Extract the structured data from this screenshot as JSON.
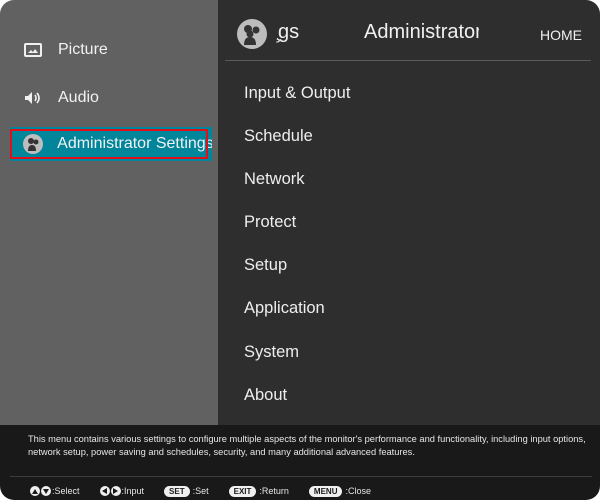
{
  "sidebar": {
    "items": [
      {
        "label": "Picture",
        "icon": "picture-icon",
        "active": false
      },
      {
        "label": "Audio",
        "icon": "speaker-icon",
        "active": false
      },
      {
        "label": "Administrator Settings",
        "icon": "admin-gears-icon",
        "active": true
      }
    ]
  },
  "header": {
    "left_label": "̧gs",
    "title": "Administrator Settings",
    "home_label": "HOME"
  },
  "menu": {
    "items": [
      "Input & Output",
      "Schedule",
      "Network",
      "Protect",
      "Setup",
      "Application",
      "System",
      "About"
    ]
  },
  "footer": {
    "description": "This menu contains various settings to configure multiple aspects of the monitor's performance and functionality, including input options, network setup, power saving and schedules, security, and many additional advanced features.",
    "hints": [
      {
        "keys": "up-down",
        "label": ":Select"
      },
      {
        "keys": "left-right",
        "label": ":Input"
      },
      {
        "keys": "SET",
        "label": ":Set"
      },
      {
        "keys": "EXIT",
        "label": ":Return"
      },
      {
        "keys": "MENU",
        "label": ":Close"
      }
    ]
  },
  "colors": {
    "accent": "#00859b",
    "focus_border": "#e0101a"
  }
}
